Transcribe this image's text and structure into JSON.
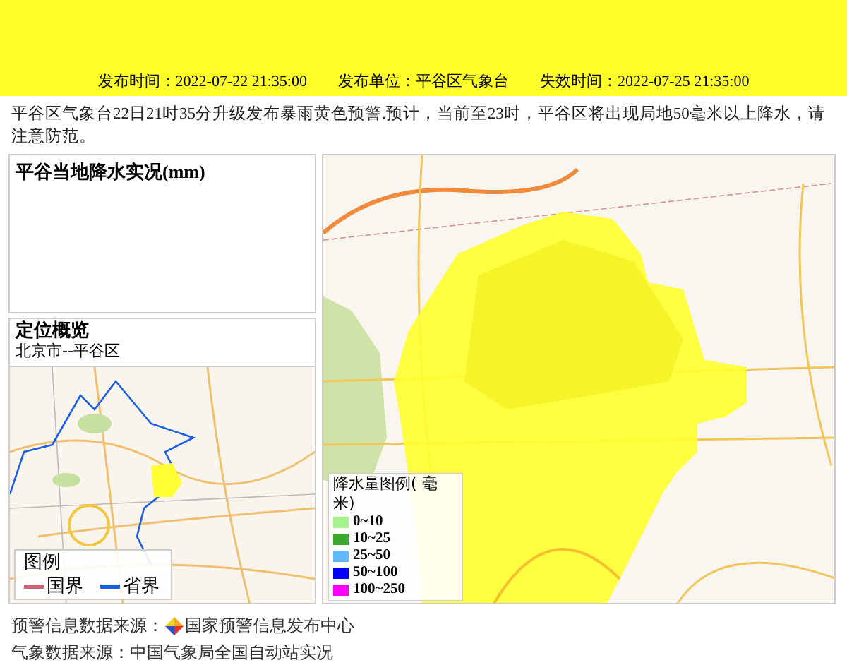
{
  "header": {
    "items": [
      "发布时间：2022-07-22 21:35:00",
      "发布单位：平谷区气象台",
      "失效时间：2022-07-25 21:35:00"
    ]
  },
  "description": "平谷区气象台22日21时35分升级发布暴雨黄色预警.预计，当前至23时，平谷区将出现局地50毫米以上降水，请注意防范。",
  "rainfall_panel": {
    "title": "平谷当地降水实况(mm)"
  },
  "location_panel": {
    "title": "定位概览",
    "subtitle": "北京市--平谷区",
    "legend": {
      "title": "图例",
      "items": [
        {
          "label": "国界",
          "color": "#c86474"
        },
        {
          "label": "省界",
          "color": "#1a5ee8"
        }
      ]
    }
  },
  "rain_map": {
    "legend": {
      "title": "降水量图例( 毫米)",
      "items": [
        {
          "label": "0~10",
          "color": "#a6f28f"
        },
        {
          "label": "10~25",
          "color": "#3da82e"
        },
        {
          "label": "25~50",
          "color": "#61b8ff"
        },
        {
          "label": "50~100",
          "color": "#0000fe"
        },
        {
          "label": "100~250",
          "color": "#fa00fa"
        }
      ]
    }
  },
  "footer": {
    "warning_source_label": "预警信息数据来源：",
    "warning_source": "国家预警信息发布中心",
    "weather_source": "气象数据来源：中国气象局全国自动站实况"
  }
}
